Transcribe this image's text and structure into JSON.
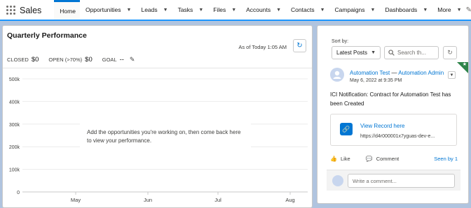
{
  "app": {
    "name": "Sales"
  },
  "nav": {
    "items": [
      {
        "label": "Home",
        "active": true,
        "dropdown": false
      },
      {
        "label": "Opportunities",
        "dropdown": true
      },
      {
        "label": "Leads",
        "dropdown": true
      },
      {
        "label": "Tasks",
        "dropdown": true
      },
      {
        "label": "Files",
        "dropdown": true
      },
      {
        "label": "Accounts",
        "dropdown": true
      },
      {
        "label": "Contacts",
        "dropdown": true
      },
      {
        "label": "Campaigns",
        "dropdown": true
      },
      {
        "label": "Dashboards",
        "dropdown": true
      },
      {
        "label": "More",
        "dropdown": true
      }
    ]
  },
  "performance": {
    "title": "Quarterly Performance",
    "as_of": "As of Today 1:05 AM",
    "closed_label": "CLOSED",
    "closed_value": "$0",
    "open_label": "OPEN (>70%)",
    "open_value": "$0",
    "goal_label": "GOAL",
    "goal_value": "--",
    "empty_message": "Add the opportunities you're working on, then come back here to view your performance."
  },
  "chart_data": {
    "type": "line",
    "categories": [
      "May",
      "Jun",
      "Jul",
      "Aug"
    ],
    "yticks": [
      "500k",
      "400k",
      "300k",
      "200k",
      "100k",
      "0"
    ],
    "ylim": [
      0,
      500000
    ],
    "series": []
  },
  "feed": {
    "sort_label": "Sort by:",
    "sort_value": "Latest Posts",
    "search_placeholder": "Search th...",
    "post": {
      "author": "Automation Test",
      "separator": "—",
      "target": "Automation Admin",
      "date": "May 6, 2022 at 9:35 PM",
      "body": "ICI Notification: Contract for Automation Test has been Created",
      "record_title": "View Record here",
      "record_url": "https://d4r000001x7yguas-dev-e..."
    },
    "like_label": "Like",
    "comment_label": "Comment",
    "seen_by": "Seen by 1",
    "comment_placeholder": "Write a comment..."
  },
  "colors": {
    "brand": "#0176d3",
    "nav_underline": "#1b96ff",
    "badge": "#2e844a"
  }
}
